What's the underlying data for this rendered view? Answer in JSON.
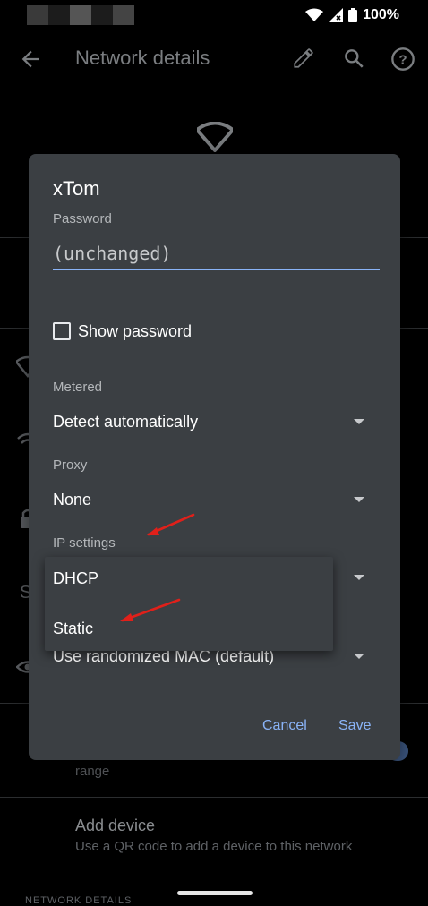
{
  "status_bar": {
    "battery_text": "100%",
    "icons": [
      "wifi-icon",
      "signal-icon",
      "battery-icon"
    ]
  },
  "app_bar": {
    "title": "Network details",
    "icons": [
      "back-arrow-icon",
      "edit-pencil-icon",
      "search-icon",
      "help-icon"
    ]
  },
  "background": {
    "range_text": "range",
    "add_device_title": "Add device",
    "add_device_subtitle": "Use a QR code to add a device to this network",
    "section_header": "NETWORK DETAILS"
  },
  "dialog": {
    "title": "xTom",
    "password_label": "Password",
    "password_value": "(unchanged)",
    "show_password_label": "Show password",
    "show_password_checked": false,
    "metered_label": "Metered",
    "metered_value": "Detect automatically",
    "proxy_label": "Proxy",
    "proxy_value": "None",
    "ip_settings_label": "IP settings",
    "privacy_value": "Use randomized MAC (default)",
    "cancel_label": "Cancel",
    "save_label": "Save"
  },
  "ip_dropdown": {
    "options": [
      "DHCP",
      "Static"
    ]
  },
  "colors": {
    "dialog_bg": "#3b3f43",
    "accent": "#8ab4f8",
    "annotation_arrow": "#e0201a"
  }
}
